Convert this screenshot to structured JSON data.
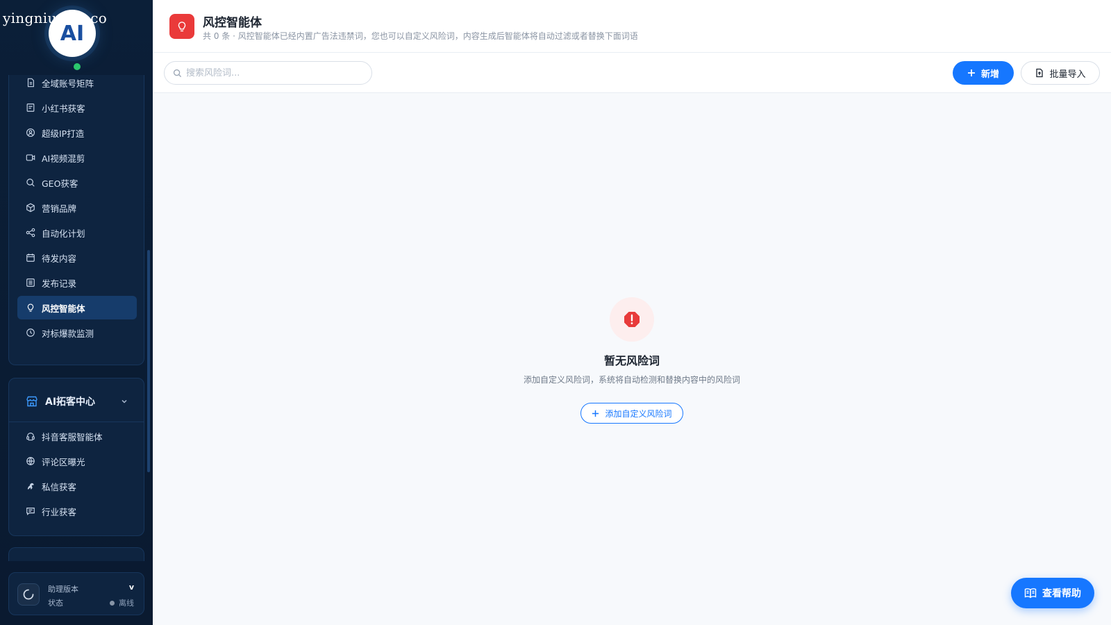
{
  "watermark": "yingniu.10v.co",
  "logo": {
    "text": "AI"
  },
  "sidebar": {
    "items": [
      {
        "label": "全域账号矩阵",
        "icon": "document-icon"
      },
      {
        "label": "小红书获客",
        "icon": "book-icon"
      },
      {
        "label": "超级IP打造",
        "icon": "user-badge-icon"
      },
      {
        "label": "AI视频混剪",
        "icon": "video-icon"
      },
      {
        "label": "GEO获客",
        "icon": "search-icon"
      },
      {
        "label": "营销品牌",
        "icon": "cube-icon"
      },
      {
        "label": "自动化计划",
        "icon": "share-icon"
      },
      {
        "label": "待发内容",
        "icon": "calendar-icon"
      },
      {
        "label": "发布记录",
        "icon": "list-icon"
      },
      {
        "label": "风控智能体",
        "icon": "lightbulb-icon",
        "active": true
      },
      {
        "label": "对标爆款监测",
        "icon": "refresh-icon"
      }
    ],
    "group": {
      "title": "AI拓客中心",
      "icon": "storefront-icon",
      "items": [
        {
          "label": "抖音客服智能体",
          "icon": "headset-icon"
        },
        {
          "label": "评论区曝光",
          "icon": "globe-icon"
        },
        {
          "label": "私信获客",
          "icon": "horse-icon"
        },
        {
          "label": "行业获客",
          "icon": "chat-icon"
        }
      ]
    },
    "status": {
      "label": "助理版本",
      "version": "v",
      "sub_label": "状态",
      "state": "离线"
    }
  },
  "header": {
    "title": "风控智能体",
    "subtitle": "共 0 条 · 风控智能体已经内置广告法违禁词，您也可以自定义风险词，内容生成后智能体将自动过滤或者替换下面词语"
  },
  "toolbar": {
    "search_placeholder": "搜索风险词...",
    "add_label": "新增",
    "import_label": "批量导入"
  },
  "empty": {
    "title": "暂无风险词",
    "description": "添加自定义风险词，系统将自动检测和替换内容中的风险词",
    "button_label": "添加自定义风险词"
  },
  "help": {
    "label": "查看帮助"
  },
  "colors": {
    "accent": "#1677ff",
    "danger": "#ea3a3a",
    "sidebar_bg": "#0b1f38",
    "online": "#2bc76d"
  }
}
